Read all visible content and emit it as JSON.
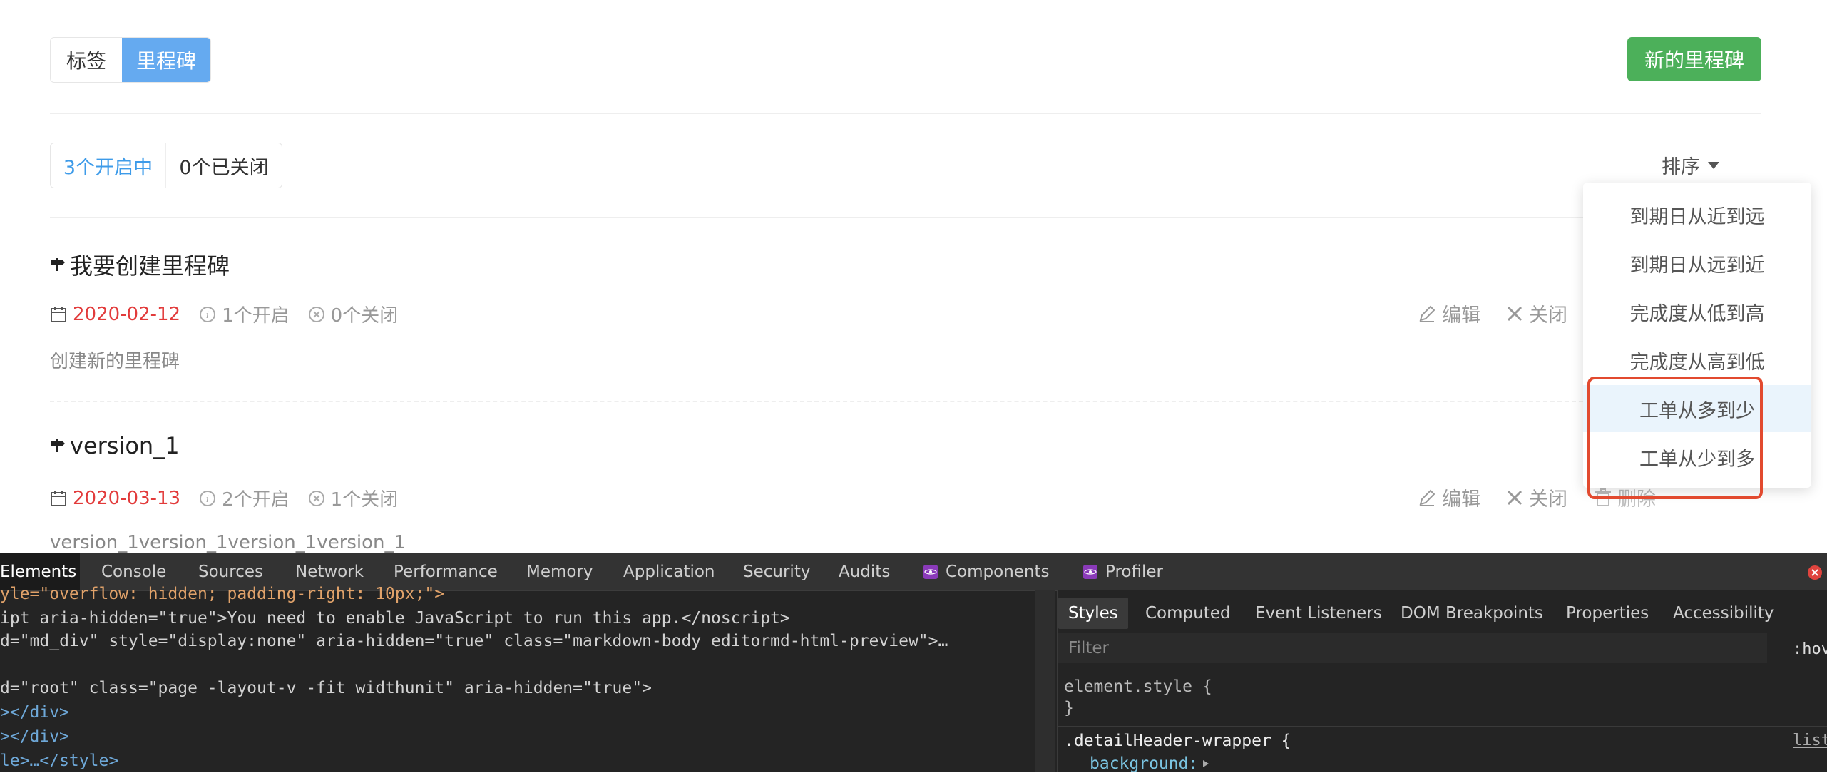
{
  "header": {
    "tabs": [
      {
        "label": "标签"
      },
      {
        "label": "里程碑"
      }
    ],
    "new_button": "新的里程碑"
  },
  "status_filter": {
    "open": "3个开启中",
    "closed": "0个已关闭"
  },
  "sort": {
    "label": "排序",
    "options": [
      "到期日从近到远",
      "到期日从远到近",
      "完成度从低到高",
      "完成度从高到低",
      "工单从多到少",
      "工单从少到多"
    ]
  },
  "milestones": [
    {
      "title": "我要创建里程碑",
      "date": "2020-02-12",
      "open": "1个开启",
      "closed": "0个关闭",
      "description": "创建新的里程碑",
      "edit": "编辑",
      "close": "关闭"
    },
    {
      "title": "version_1",
      "date": "2020-03-13",
      "open": "2个开启",
      "closed": "1个关闭",
      "description": "version_1version_1version_1version_1",
      "edit": "编辑",
      "close": "关闭",
      "delete": "删除"
    }
  ],
  "devtools": {
    "tabs": [
      "Elements",
      "Console",
      "Sources",
      "Network",
      "Performance",
      "Memory",
      "Application",
      "Security",
      "Audits",
      "Components",
      "Profiler"
    ],
    "code_lines": [
      "yle=\"overflow: hidden; padding-right: 10px;\">",
      "ipt aria-hidden=\"true\">You need to enable JavaScript to run this app.</noscript>",
      "d=\"md_div\" style=\"display:none\" aria-hidden=\"true\" class=\"markdown-body editormd-html-preview\">…",
      "d=\"root\" class=\"page -layout-v -fit widthunit\" aria-hidden=\"true\">",
      "></div>",
      "></div>",
      "le>…</style>"
    ],
    "style_tabs": [
      "Styles",
      "Computed",
      "Event Listeners",
      "DOM Breakpoints",
      "Properties",
      "Accessibility"
    ],
    "filter_placeholder": "Filter",
    "hov": ":hov",
    "element_style": "element.style {",
    "brace": "}",
    "selector": ".detailHeader-wrapper {",
    "property": "background:",
    "source_link": "list"
  }
}
